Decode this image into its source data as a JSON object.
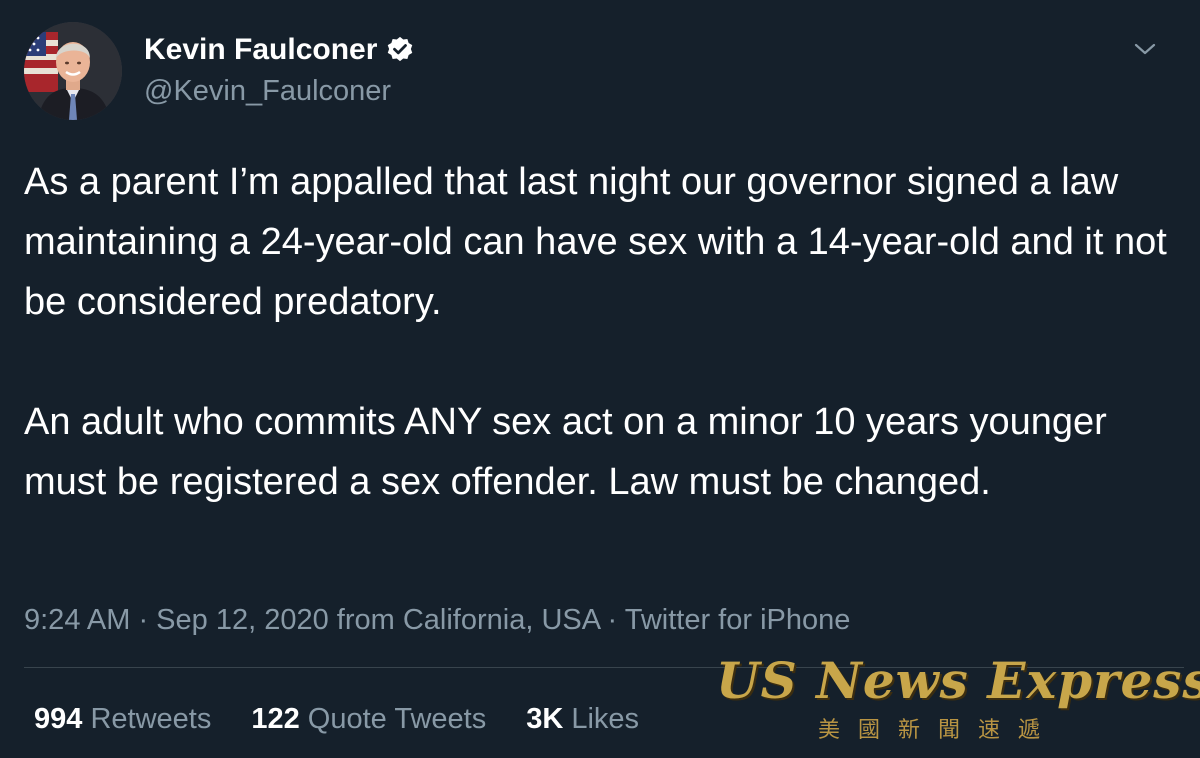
{
  "author": {
    "display_name": "Kevin Faulconer",
    "handle": "@Kevin_Faulconer",
    "verified": true
  },
  "tweet": {
    "paragraphs": [
      "As a parent I’m appalled that last night our governor signed a law maintaining a 24-year-old can have sex with a 14-year-old and it not be considered predatory.",
      "An adult who commits ANY sex act on a minor 10 years younger must be registered a sex offender. Law must be changed."
    ],
    "meta": "9:24 AM · Sep 12, 2020 from California, USA · Twitter for iPhone"
  },
  "stats": [
    {
      "count": "994",
      "label": "Retweets"
    },
    {
      "count": "122",
      "label": "Quote Tweets"
    },
    {
      "count": "3K",
      "label": "Likes"
    }
  ],
  "watermark": {
    "title": "US News Express",
    "subtitle": "美國新聞速遞"
  },
  "icons": {
    "verified": "verified-badge-icon",
    "menu": "chevron-down-icon"
  },
  "colors": {
    "background": "#15202b",
    "text": "#ffffff",
    "secondary_text": "#8899a6",
    "divider": "#38444d"
  }
}
